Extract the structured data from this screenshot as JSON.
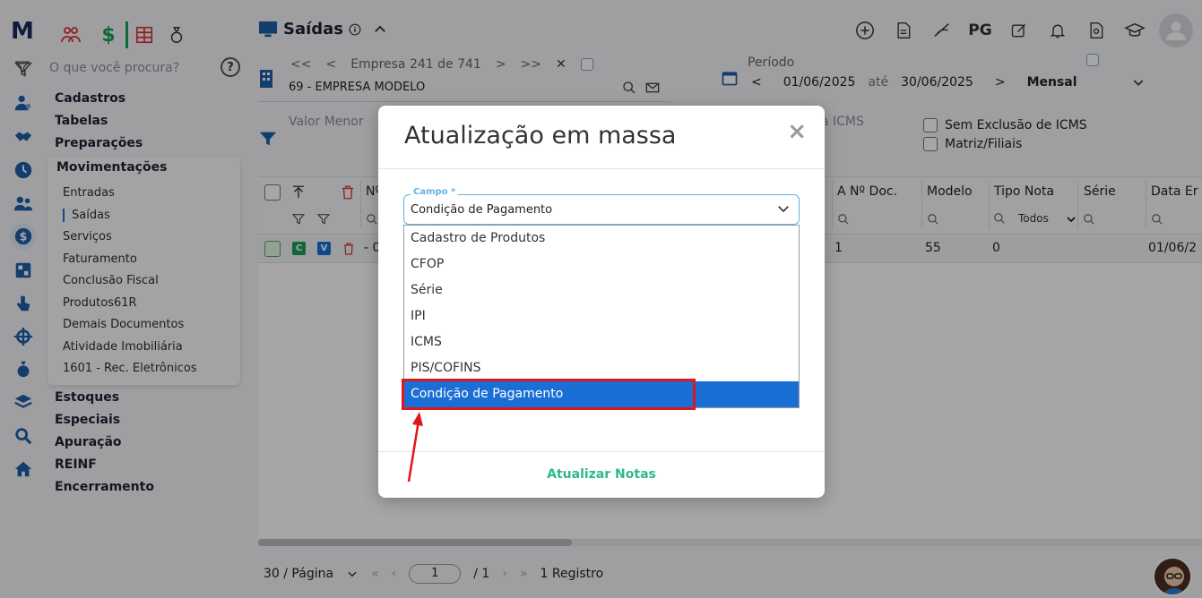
{
  "sidebar": {
    "logo": "M",
    "search_placeholder": "O que você procura?",
    "help_label": "?",
    "menu_top": [
      "Cadastros",
      "Tabelas",
      "Preparações"
    ],
    "submenu_title": "Movimentações",
    "submenu_items": [
      "Entradas",
      "Saídas",
      "Serviços",
      "Faturamento",
      "Conclusão Fiscal",
      "Produtos61R",
      "Demais Documentos",
      "Atividade Imobiliária",
      "1601 - Rec. Eletrônicos"
    ],
    "submenu_active": "Saídas",
    "menu_bottom": [
      "Estoques",
      "Especiais",
      "Apuração",
      "REINF",
      "Encerramento"
    ]
  },
  "header": {
    "title": "Saídas",
    "pg_label": "PG"
  },
  "empresa": {
    "label": "Empresa",
    "current": "241",
    "of": "de",
    "total": "741",
    "name": "69 - EMPRESA MODELO"
  },
  "periodo": {
    "label": "Período",
    "start": "01/06/2025",
    "sep": "até",
    "end": "30/06/2025",
    "mode": "Mensal"
  },
  "filters": {
    "valor_menor": "Valor Menor",
    "icms_partial": "a ICMS",
    "sem_exclusao": "Sem Exclusão de ICMS",
    "matriz_filiais": "Matriz/Filiais"
  },
  "table": {
    "headers": [
      "Nº",
      "A Nº Doc.",
      "Modelo",
      "Tipo Nota",
      "Série",
      "Data Er"
    ],
    "tipo_nota_filter": "Todos",
    "row": {
      "badge_c": "C",
      "badge_v": "V",
      "dash": "- 0",
      "doc": "1",
      "modelo": "55",
      "tipo": "0",
      "data": "01/06/2"
    }
  },
  "pager": {
    "per_page": "30 / Página",
    "page": "1",
    "total_pages": "/ 1",
    "records": "1 Registro"
  },
  "modal": {
    "title": "Atualização em massa",
    "close": "×",
    "field_label": "Campo *",
    "field_value": "Condição de Pagamento",
    "options": [
      "Cadastro de Produtos",
      "CFOP",
      "Série",
      "IPI",
      "ICMS",
      "PIS/COFINS",
      "Condição de Pagamento"
    ],
    "selected_option": "Condição de Pagamento",
    "action": "Atualizar Notas"
  },
  "colors": {
    "accent_blue": "#1a6fd6",
    "teal": "#2fb98a",
    "highlight_red": "#e0161d"
  }
}
